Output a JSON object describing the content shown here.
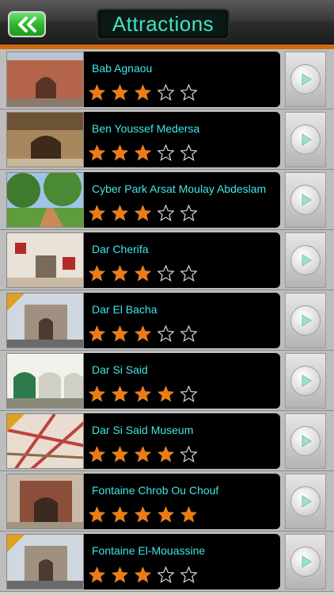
{
  "header": {
    "title": "Attractions",
    "back_icon": "double-chevron-left-icon"
  },
  "colors": {
    "accent_text": "#46e0c8",
    "item_text": "#3ee6e6",
    "star_filled": "#f07a10",
    "back_button": "#2fb82f",
    "strip": "#d06a10"
  },
  "items": [
    {
      "name": "Bab Agnaou",
      "rating": 3,
      "thumb": "gate-photo"
    },
    {
      "name": "Ben Youssef Medersa",
      "rating": 3,
      "thumb": "courtyard-photo"
    },
    {
      "name": "Cyber Park Arsat Moulay Abdeslam",
      "rating": 3,
      "thumb": "park-photo"
    },
    {
      "name": "Dar Cherifa",
      "rating": 3,
      "thumb": "interior-photo"
    },
    {
      "name": "Dar El Bacha",
      "rating": 3,
      "thumb": "monument-photo"
    },
    {
      "name": "Dar Si Said",
      "rating": 4,
      "thumb": "arches-photo"
    },
    {
      "name": "Dar Si Said Museum",
      "rating": 4,
      "thumb": "map-photo"
    },
    {
      "name": "Fontaine Chrob Ou Chouf",
      "rating": 5,
      "thumb": "fountain-photo"
    },
    {
      "name": "Fontaine El-Mouassine",
      "rating": 3,
      "thumb": "monument-photo"
    }
  ]
}
